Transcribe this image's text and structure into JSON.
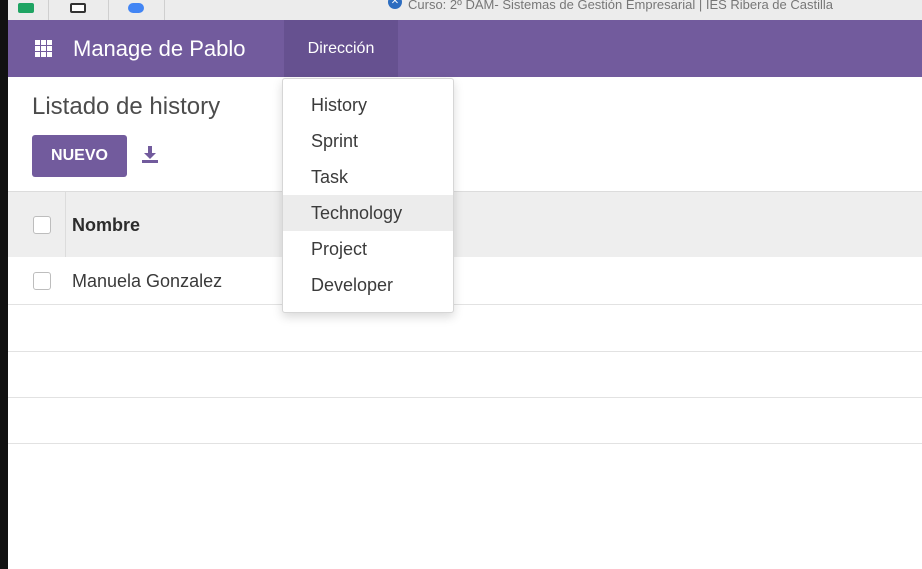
{
  "browser": {
    "tab_title": "Curso: 2º DAM- Sistemas de Gestión Empresarial | IES Ribera de Castilla"
  },
  "navbar": {
    "apps_icon": "grid-icon",
    "brand": "Manage de Pablo",
    "menu": "Dirección",
    "background_color": "#725b9d"
  },
  "control_panel": {
    "title": "Listado de history",
    "new_button": "NUEVO",
    "download_icon": "download-icon"
  },
  "list": {
    "columns": [
      "Nombre"
    ],
    "rows": [
      {
        "nombre": "Manuela Gonzalez"
      }
    ]
  },
  "dropdown": {
    "items": [
      "History",
      "Sprint",
      "Task",
      "Technology",
      "Project",
      "Developer"
    ],
    "highlighted": "Technology"
  }
}
